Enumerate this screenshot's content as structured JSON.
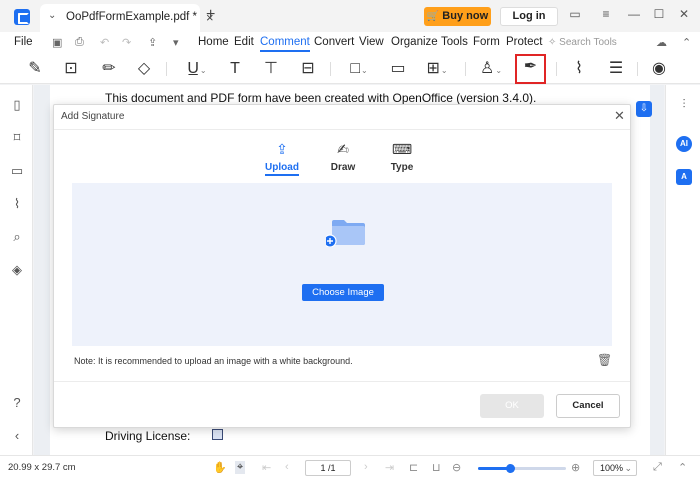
{
  "titlebar": {
    "tab_chevron": "⌄",
    "tab_title": "OoPdfFormExample.pdf *",
    "tab_close": "×",
    "new_tab": "+",
    "buy_now": "Buy now",
    "buy_icon": "cart-icon",
    "log_in": "Log in",
    "window_icons": [
      "feedback-icon",
      "menu-icon",
      "minimize-icon",
      "maximize-icon",
      "close-icon"
    ]
  },
  "menubar": {
    "items": [
      "File",
      "Home",
      "Edit",
      "Comment",
      "Convert",
      "View",
      "Organize",
      "Tools",
      "Form",
      "Protect"
    ],
    "active": "Comment",
    "search_tools": "Search Tools"
  },
  "toolbar": {
    "tools": [
      "highlight-icon",
      "text-box-comment-icon",
      "pencil-icon",
      "eraser-icon",
      "underline-icon",
      "text-icon",
      "textbox-icon",
      "callout-icon",
      "shape-icon",
      "note-icon",
      "measure-icon",
      "stamp-icon",
      "signature-icon",
      "attachment-icon",
      "form-icon",
      "eye-icon"
    ],
    "highlighted_tool": "signature-icon"
  },
  "document": {
    "line1": "This document and PDF form have been created with OpenOffice (version 3.4.0).",
    "license_label": "Driving License:"
  },
  "dialog": {
    "title": "Add Signature",
    "tabs": [
      {
        "label": "Upload",
        "icon": "upload-icon",
        "active": true
      },
      {
        "label": "Draw",
        "icon": "draw-pen-icon",
        "active": false
      },
      {
        "label": "Type",
        "icon": "keyboard-icon",
        "active": false
      }
    ],
    "choose_image": "Choose Image",
    "note": "Note: It is recommended to upload an image with a white background.",
    "ok": "OK",
    "cancel": "Cancel"
  },
  "statusbar": {
    "page_size": "20.99 x 29.7 cm",
    "page_indicator": "1 /1",
    "zoom": "100%",
    "zoom_fraction": 0.36
  },
  "colors": {
    "accent": "#1e6ff1",
    "buy_now": "#ff9f1a",
    "highlight_border": "#e02525"
  }
}
